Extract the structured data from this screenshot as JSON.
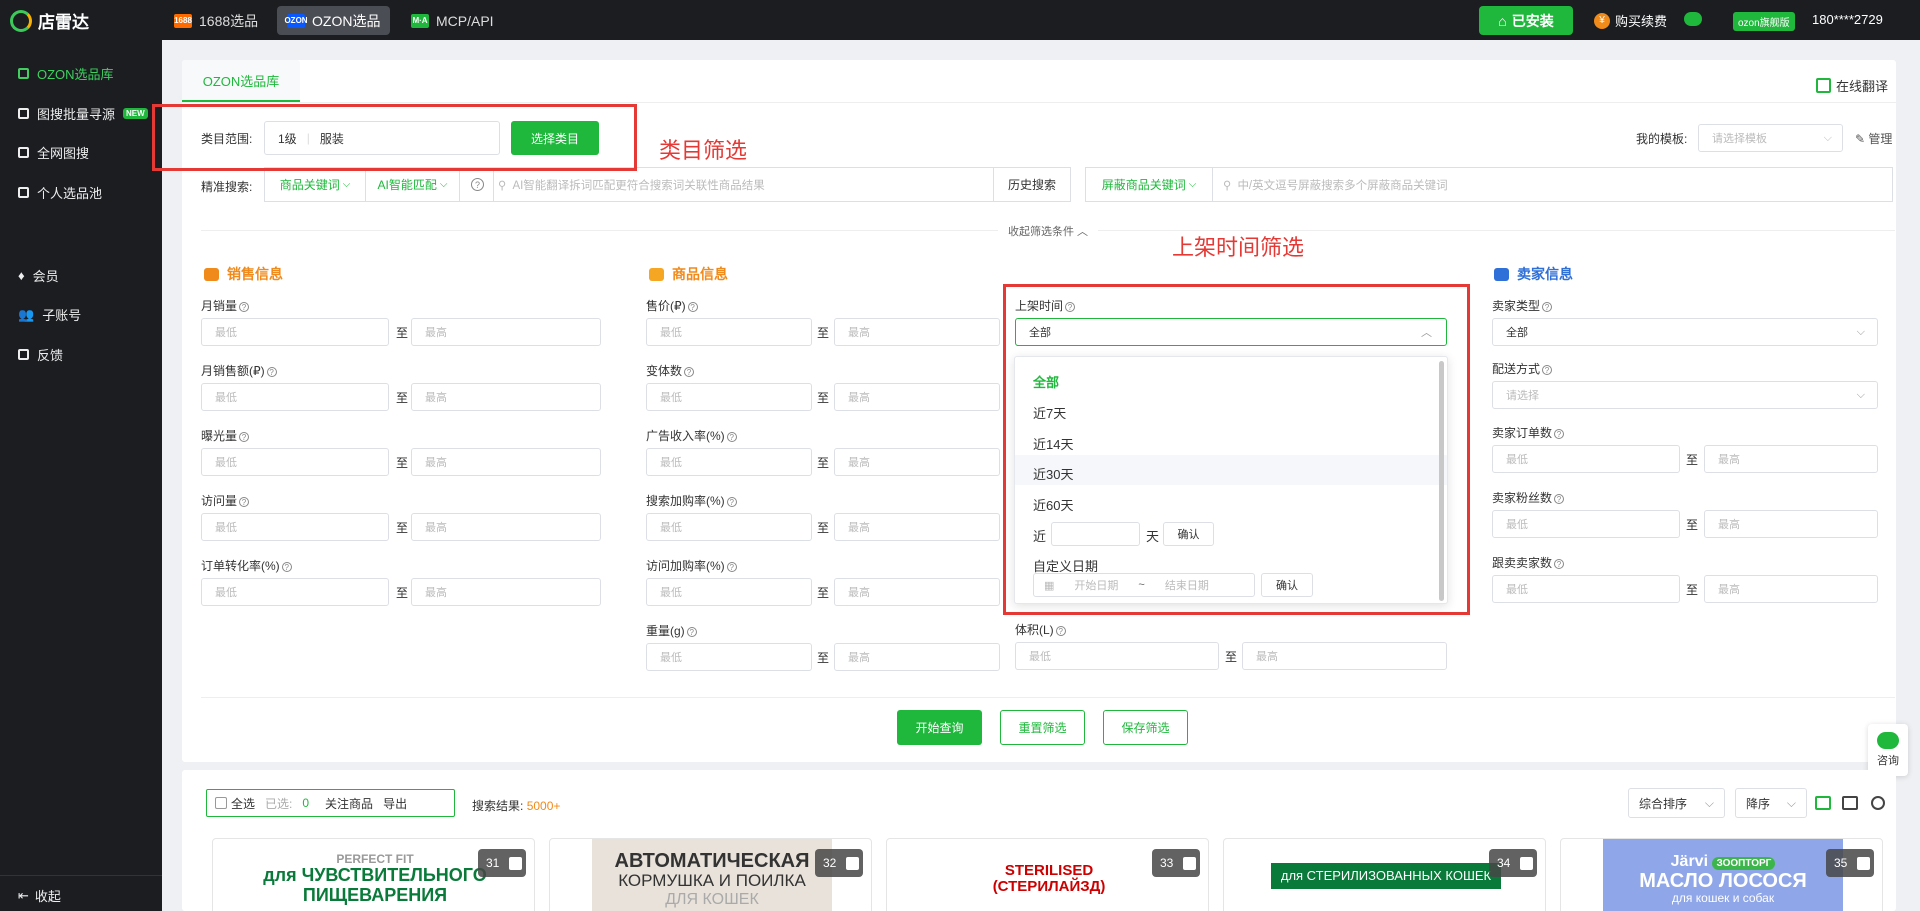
{
  "topbar": {
    "brand": "店雷达",
    "tabs": [
      {
        "icon": "1688",
        "label": "1688选品"
      },
      {
        "icon": "OZON",
        "label": "OZON选品"
      },
      {
        "icon": "M·A",
        "label": "MCP/API"
      }
    ],
    "installed": "已安装",
    "buy": "购买续费",
    "buy_icon": "¥",
    "vip": "ozon旗舰版",
    "account": "180****2729"
  },
  "sidebar": {
    "items": [
      "OZON选品库",
      "图搜批量寻源",
      "全网图搜",
      "个人选品池",
      "会员",
      "子账号",
      "反馈"
    ],
    "new_badge": "NEW",
    "collapse": "收起"
  },
  "panel": {
    "tab": "OZON选品库",
    "translate": "在线翻译",
    "category_label": "类目范围:",
    "category_level": "1级",
    "category_value": "服装",
    "choose_category": "选择类目",
    "template_label": "我的模板:",
    "template_placeholder": "请选择模板",
    "manage": "管理",
    "search_label": "精准搜索:",
    "keyword_type": "商品关键词",
    "ai_match": "AI智能匹配",
    "ai_placeholder": "AI智能翻译拆词匹配更符合搜索词关联性商品结果",
    "history": "历史搜索",
    "block_type": "屏蔽商品关键词",
    "block_placeholder": "中/英文逗号屏蔽搜索多个屏蔽商品关键词",
    "collapse_filters": "收起筛选条件",
    "to": "至",
    "min": "最低",
    "max": "最高"
  },
  "sections": {
    "sales": {
      "title": "销售信息",
      "fields": [
        "月销量",
        "月销售额(₽)",
        "曝光量",
        "访问量",
        "订单转化率(%)"
      ]
    },
    "product": {
      "title": "商品信息",
      "fields": [
        "售价(₽)",
        "变体数",
        "广告收入率(%)",
        "搜索加购率(%)",
        "访问加购率(%)",
        "重量(g)"
      ]
    },
    "listing": {
      "label": "上架时间",
      "value": "全部",
      "volume": "体积(L)"
    },
    "seller": {
      "title": "卖家信息",
      "seller_type": "卖家类型",
      "seller_type_value": "全部",
      "delivery": "配送方式",
      "delivery_placeholder": "请选择",
      "orders": "卖家订单数",
      "fans": "卖家粉丝数",
      "followers": "跟卖卖家数"
    }
  },
  "dropdown": {
    "options": [
      "全部",
      "近7天",
      "近14天",
      "近30天",
      "近60天"
    ],
    "recent_prefix": "近",
    "recent_suffix": "天",
    "confirm": "确认",
    "custom_label": "自定义日期",
    "start_date": "开始日期",
    "tilde": "~",
    "end_date": "结束日期"
  },
  "actions": {
    "query": "开始查询",
    "reset": "重置筛选",
    "save": "保存筛选"
  },
  "annotations": {
    "category": "类目筛选",
    "listing_time": "上架时间筛选"
  },
  "chat": "咨询",
  "results": {
    "select_all": "全选",
    "selected_label": "已选:",
    "selected_count": "0",
    "follow": "关注商品",
    "export": "导出",
    "result_label": "搜索结果:",
    "result_count": "5000+",
    "sort": "综合排序",
    "order": "降序"
  },
  "cards": [
    {
      "num": "31",
      "lines": [
        "PERFECT FIT",
        "для ЧУВСТВИТЕЛЬНОГО",
        "ПИЩЕВАРЕНИЯ"
      ]
    },
    {
      "num": "32",
      "lines": [
        "АВТОМАТИЧЕСКАЯ",
        "КОРМУШКА И ПОИЛКА",
        "ДЛЯ КОШЕК"
      ]
    },
    {
      "num": "33",
      "lines": [
        "STERILISED",
        "(СТЕРИЛАЙЗД)"
      ]
    },
    {
      "num": "34",
      "lines": [
        "для СТЕРИЛИЗОВАННЫХ КОШЕК"
      ]
    },
    {
      "num": "35",
      "lines": [
        "Järvi",
        "ЗООПТОРГ",
        "МАСЛО ЛОСОСЯ",
        "для кошек и собак"
      ]
    }
  ]
}
